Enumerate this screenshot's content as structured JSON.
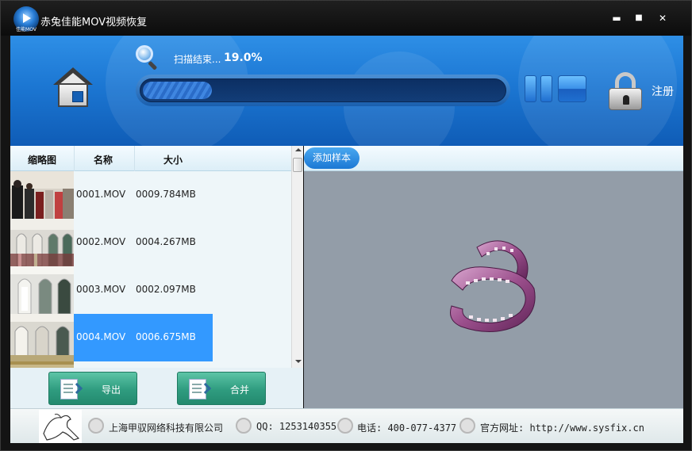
{
  "window": {
    "title": "赤兔佳能MOV视频恢复",
    "logo_caption": "佳能MOV",
    "controls": {
      "minimize": "▬",
      "maximize": "■",
      "close": "✕"
    }
  },
  "toolbar": {
    "scan_status": "扫描结束...",
    "scan_percent": "19.0%",
    "progress": 0.19,
    "register_label": "注册"
  },
  "list": {
    "columns": [
      "缩略图",
      "名称",
      "大小"
    ],
    "rows": [
      {
        "name": "0001.MOV",
        "size": "0009.784MB",
        "selected": false
      },
      {
        "name": "0002.MOV",
        "size": "0004.267MB",
        "selected": false
      },
      {
        "name": "0003.MOV",
        "size": "0002.097MB",
        "selected": false
      },
      {
        "name": "0004.MOV",
        "size": "0006.675MB",
        "selected": true
      }
    ]
  },
  "actions": {
    "export_label": "导出",
    "merge_label": "合并"
  },
  "preview": {
    "add_sample_label": "添加样本"
  },
  "footer": {
    "company": "上海甲驭网络科技有限公司",
    "qq": "QQ: 1253140355",
    "phone": "电话: 400-077-4377",
    "website": "官方网址: http://www.sysfix.cn"
  }
}
